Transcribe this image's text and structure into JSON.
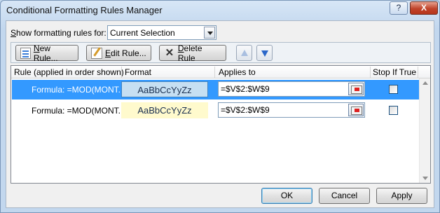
{
  "window": {
    "title": "Conditional Formatting Rules Manager",
    "help_label": "?",
    "close_label": "X"
  },
  "filter": {
    "label_prefix": "S",
    "label_rest": "how formatting rules for:",
    "selected_value": "Current Selection"
  },
  "toolbar": {
    "new_rule": {
      "accel": "N",
      "rest": "ew Rule..."
    },
    "edit_rule": {
      "accel": "E",
      "rest": "dit Rule..."
    },
    "delete_rule": {
      "accel": "D",
      "rest": "elete Rule"
    },
    "move_up_icon": "arrow-up",
    "move_down_icon": "arrow-down"
  },
  "rules_table": {
    "columns": {
      "rule": "Rule (applied in order shown)",
      "format": "Format",
      "applies_to": "Applies to",
      "stop_if_true": "Stop If True"
    },
    "rows": [
      {
        "rule": "Formula: =MOD(MONT...",
        "format_preview": "AaBbCcYyZz",
        "format_fill": "#c6dff2",
        "applies_to": "=$V$2:$W$9",
        "stop_if_true": false,
        "selected": true
      },
      {
        "rule": "Formula: =MOD(MONT...",
        "format_preview": "AaBbCcYyZz",
        "format_fill": "#fffacd",
        "applies_to": "=$V$2:$W$9",
        "stop_if_true": false,
        "selected": false
      }
    ]
  },
  "footer": {
    "ok": "OK",
    "cancel": "Cancel",
    "apply": "Apply"
  },
  "colors": {
    "selection": "#3399ff",
    "frame": "#c2d7ee"
  }
}
